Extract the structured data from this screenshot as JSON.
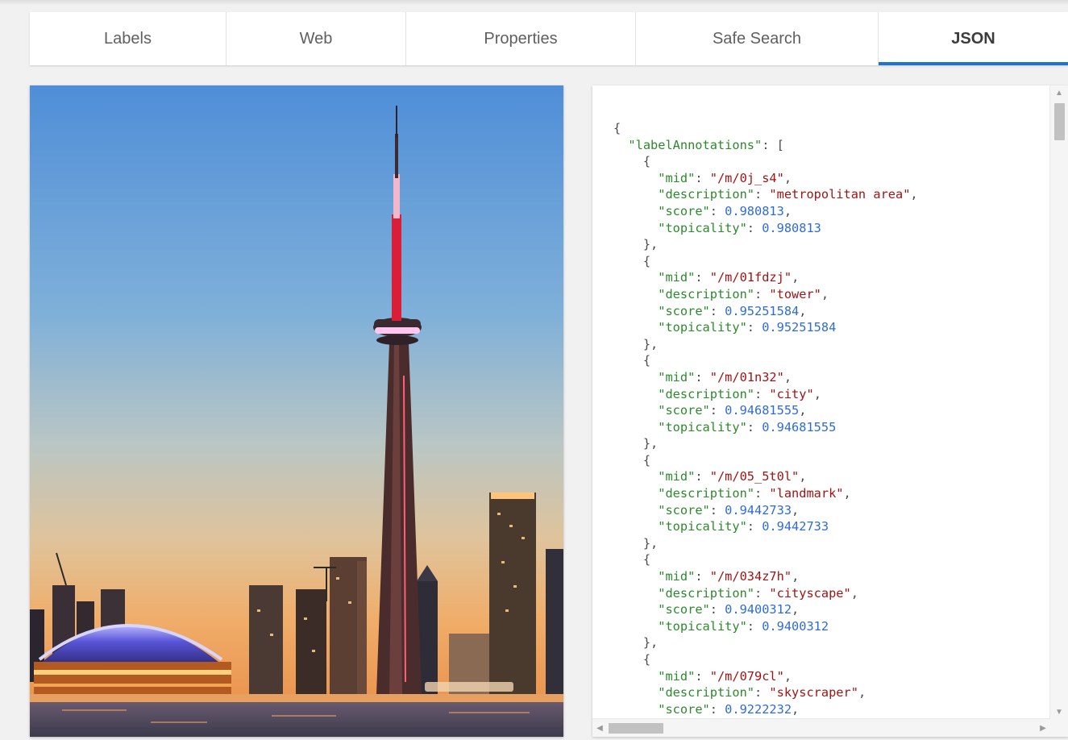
{
  "tabs": [
    {
      "label": "Labels",
      "active": false
    },
    {
      "label": "Web",
      "active": false
    },
    {
      "label": "Properties",
      "active": false
    },
    {
      "label": "Safe Search",
      "active": false
    },
    {
      "label": "JSON",
      "active": true
    }
  ],
  "image": {
    "subject": "CN Tower and Toronto skyline at dusk"
  },
  "json_root_key": "labelAnnotations",
  "label_annotations": [
    {
      "mid": "/m/0j_s4",
      "description": "metropolitan area",
      "score": "0.980813",
      "topicality": "0.980813"
    },
    {
      "mid": "/m/01fdzj",
      "description": "tower",
      "score": "0.95251584",
      "topicality": "0.95251584"
    },
    {
      "mid": "/m/01n32",
      "description": "city",
      "score": "0.94681555",
      "topicality": "0.94681555"
    },
    {
      "mid": "/m/05_5t0l",
      "description": "landmark",
      "score": "0.9442733",
      "topicality": "0.9442733"
    },
    {
      "mid": "/m/034z7h",
      "description": "cityscape",
      "score": "0.9400312",
      "topicality": "0.9400312"
    },
    {
      "mid": "/m/079cl",
      "description": "skyscraper",
      "score": "0.9222232"
    }
  ],
  "colors": {
    "key": "#2c8a2c",
    "string": "#a21313",
    "number": "#2e6bd6",
    "tab_accent": "#1e73d6"
  }
}
